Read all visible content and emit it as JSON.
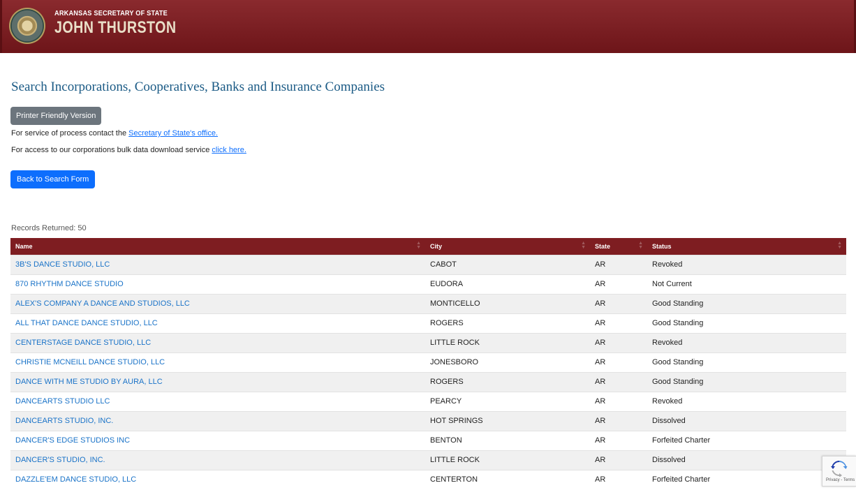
{
  "header": {
    "pretitle": "ARKANSAS SECRETARY OF STATE",
    "name": "JOHN THURSTON"
  },
  "page_title": "Search Incorporations, Cooperatives, Banks and Insurance Companies",
  "printer_button": "Printer Friendly Version",
  "service_line": {
    "text": "For service of process contact the ",
    "link": "Secretary of State's office."
  },
  "bulk_line": {
    "text": "For access to our corporations bulk data download service ",
    "link": "click here."
  },
  "back_button": "Back to Search Form",
  "records_returned": "Records Returned: 50",
  "table": {
    "columns": [
      "Name",
      "City",
      "State",
      "Status"
    ],
    "rows": [
      {
        "name": "3B'S DANCE STUDIO, LLC",
        "city": "CABOT",
        "state": "AR",
        "status": "Revoked"
      },
      {
        "name": "870 RHYTHM DANCE STUDIO",
        "city": "EUDORA",
        "state": "AR",
        "status": "Not Current"
      },
      {
        "name": "ALEX'S COMPANY A DANCE AND STUDIOS, LLC",
        "city": "MONTICELLO",
        "state": "AR",
        "status": "Good Standing"
      },
      {
        "name": "ALL THAT DANCE DANCE STUDIO, LLC",
        "city": "ROGERS",
        "state": "AR",
        "status": "Good Standing"
      },
      {
        "name": "CENTERSTAGE DANCE STUDIO, LLC",
        "city": "LITTLE ROCK",
        "state": "AR",
        "status": "Revoked"
      },
      {
        "name": "CHRISTIE MCNEILL DANCE STUDIO, LLC",
        "city": "JONESBORO",
        "state": "AR",
        "status": "Good Standing"
      },
      {
        "name": "DANCE WITH ME STUDIO BY AURA, LLC",
        "city": "ROGERS",
        "state": "AR",
        "status": "Good Standing"
      },
      {
        "name": "DANCEARTS STUDIO LLC",
        "city": "PEARCY",
        "state": "AR",
        "status": "Revoked"
      },
      {
        "name": "DANCEARTS STUDIO, INC.",
        "city": "HOT SPRINGS",
        "state": "AR",
        "status": "Dissolved"
      },
      {
        "name": "DANCER'S EDGE STUDIOS INC",
        "city": "BENTON",
        "state": "AR",
        "status": "Forfeited Charter"
      },
      {
        "name": "DANCER'S STUDIO, INC.",
        "city": "LITTLE ROCK",
        "state": "AR",
        "status": "Dissolved"
      },
      {
        "name": "DAZZLE'EM DANCE STUDIO, LLC",
        "city": "CENTERTON",
        "state": "AR",
        "status": "Forfeited Charter"
      }
    ]
  },
  "recaptcha": {
    "terms": "Privacy - Terms"
  },
  "colors": {
    "header": "#7e1d21",
    "link": "#1a73c8",
    "primary_button": "#0d6efd",
    "secondary_button": "#6c757d"
  }
}
